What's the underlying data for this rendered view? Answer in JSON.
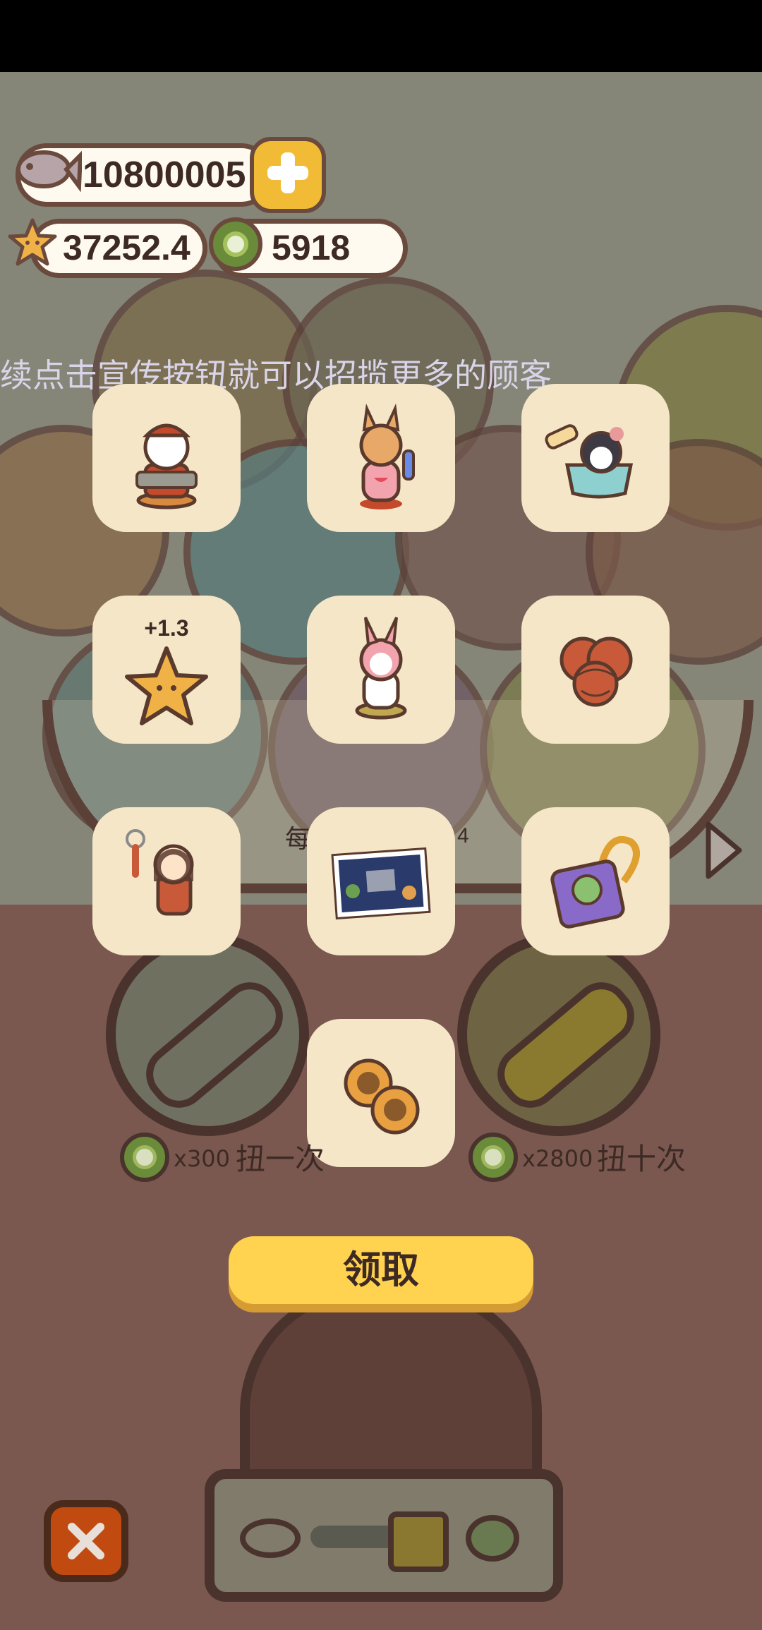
{
  "currency": {
    "fish": "10800005",
    "stars": "37252.4",
    "coins": "5918"
  },
  "marquee_text": "续点击宣传按钮就可以招揽更多的顾客",
  "rewards": [
    {
      "icon": "dog-chef-figure-icon"
    },
    {
      "icon": "corgi-pink-outfit-figure-icon"
    },
    {
      "icon": "penguin-bath-figure-icon"
    },
    {
      "icon": "star-bonus-icon",
      "bonus": "+1.3"
    },
    {
      "icon": "bunny-hood-cat-figure-icon"
    },
    {
      "icon": "basket-ball-pile-icon"
    },
    {
      "icon": "girl-keychain-icon"
    },
    {
      "icon": "photo-postcard-icon"
    },
    {
      "icon": "frog-phone-charm-icon"
    },
    {
      "icon": "sunflower-cookies-icon"
    }
  ],
  "background": {
    "partial_left": "每",
    "partial_right": "4"
  },
  "spin_one": {
    "cost": "x300",
    "label": "扭一次"
  },
  "spin_ten": {
    "cost": "x2800",
    "label": "扭十次"
  },
  "claim_button": "领取",
  "colors": {
    "tile": "#f5e6c8",
    "claim": "#ffd24f",
    "close": "#c04a10",
    "backdrop": "#7a5850"
  }
}
